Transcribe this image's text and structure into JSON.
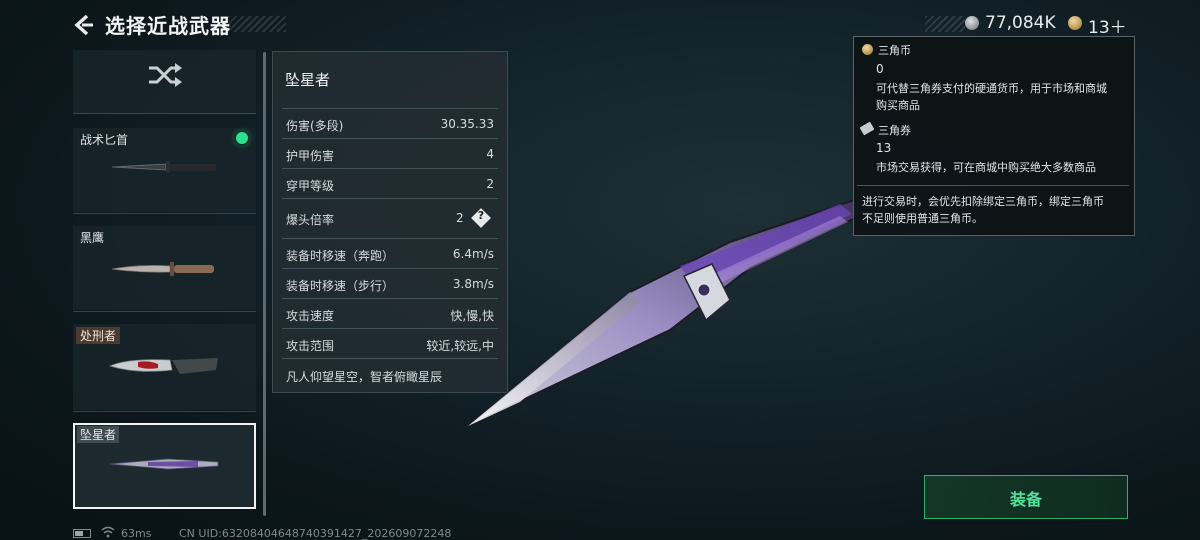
{
  "header": {
    "title": "选择近战武器"
  },
  "currency": {
    "coin1_value": "77,084K",
    "coin2_value": "13＋"
  },
  "weapon_list": [
    {
      "name": "战术匕首"
    },
    {
      "name": "黑鹰"
    },
    {
      "name": "处刑者"
    },
    {
      "name": "坠星者"
    }
  ],
  "stats": {
    "name": "坠星者",
    "rows": [
      {
        "label": "伤害(多段)",
        "value": "30.35.33"
      },
      {
        "label": "护甲伤害",
        "value": "4"
      },
      {
        "label": "穿甲等级",
        "value": "2"
      },
      {
        "label": "爆头倍率",
        "value": "2"
      },
      {
        "label": "装备时移速（奔跑）",
        "value": "6.4m/s"
      },
      {
        "label": "装备时移速（步行）",
        "value": "3.8m/s"
      },
      {
        "label": "攻击速度",
        "value": "快,慢,快"
      },
      {
        "label": "攻击范围",
        "value": "较近,较远,中"
      }
    ],
    "help_symbol": "?",
    "motto": "凡人仰望星空，智者俯瞰星辰"
  },
  "tooltip": {
    "coin1_name": "三角币",
    "coin1_amount": "0",
    "coin1_desc_1": "可代替三角券支付的硬通货币，用于市场和商城",
    "coin1_desc_2": "购买商品",
    "coin2_name": "三角券",
    "coin2_amount": "13",
    "coin2_desc": "市场交易获得，可在商城中购买绝大多数商品",
    "note_1": "进行交易时，会优先扣除绑定三角币，绑定三角币",
    "note_2": "不足则使用普通三角币。"
  },
  "equip_button": {
    "label": "装备"
  },
  "footer": {
    "ping": "63ms",
    "uid": "CN UID:63208404648740391427_202609072248"
  },
  "icons": {
    "back": "back-arrow-icon",
    "shuffle": "shuffle-icon",
    "help": "help-icon",
    "wifi": "wifi-icon",
    "battery": "battery-icon"
  },
  "colors": {
    "equip_accent": "#52e39a",
    "selected_dot": "#2fe08f"
  }
}
